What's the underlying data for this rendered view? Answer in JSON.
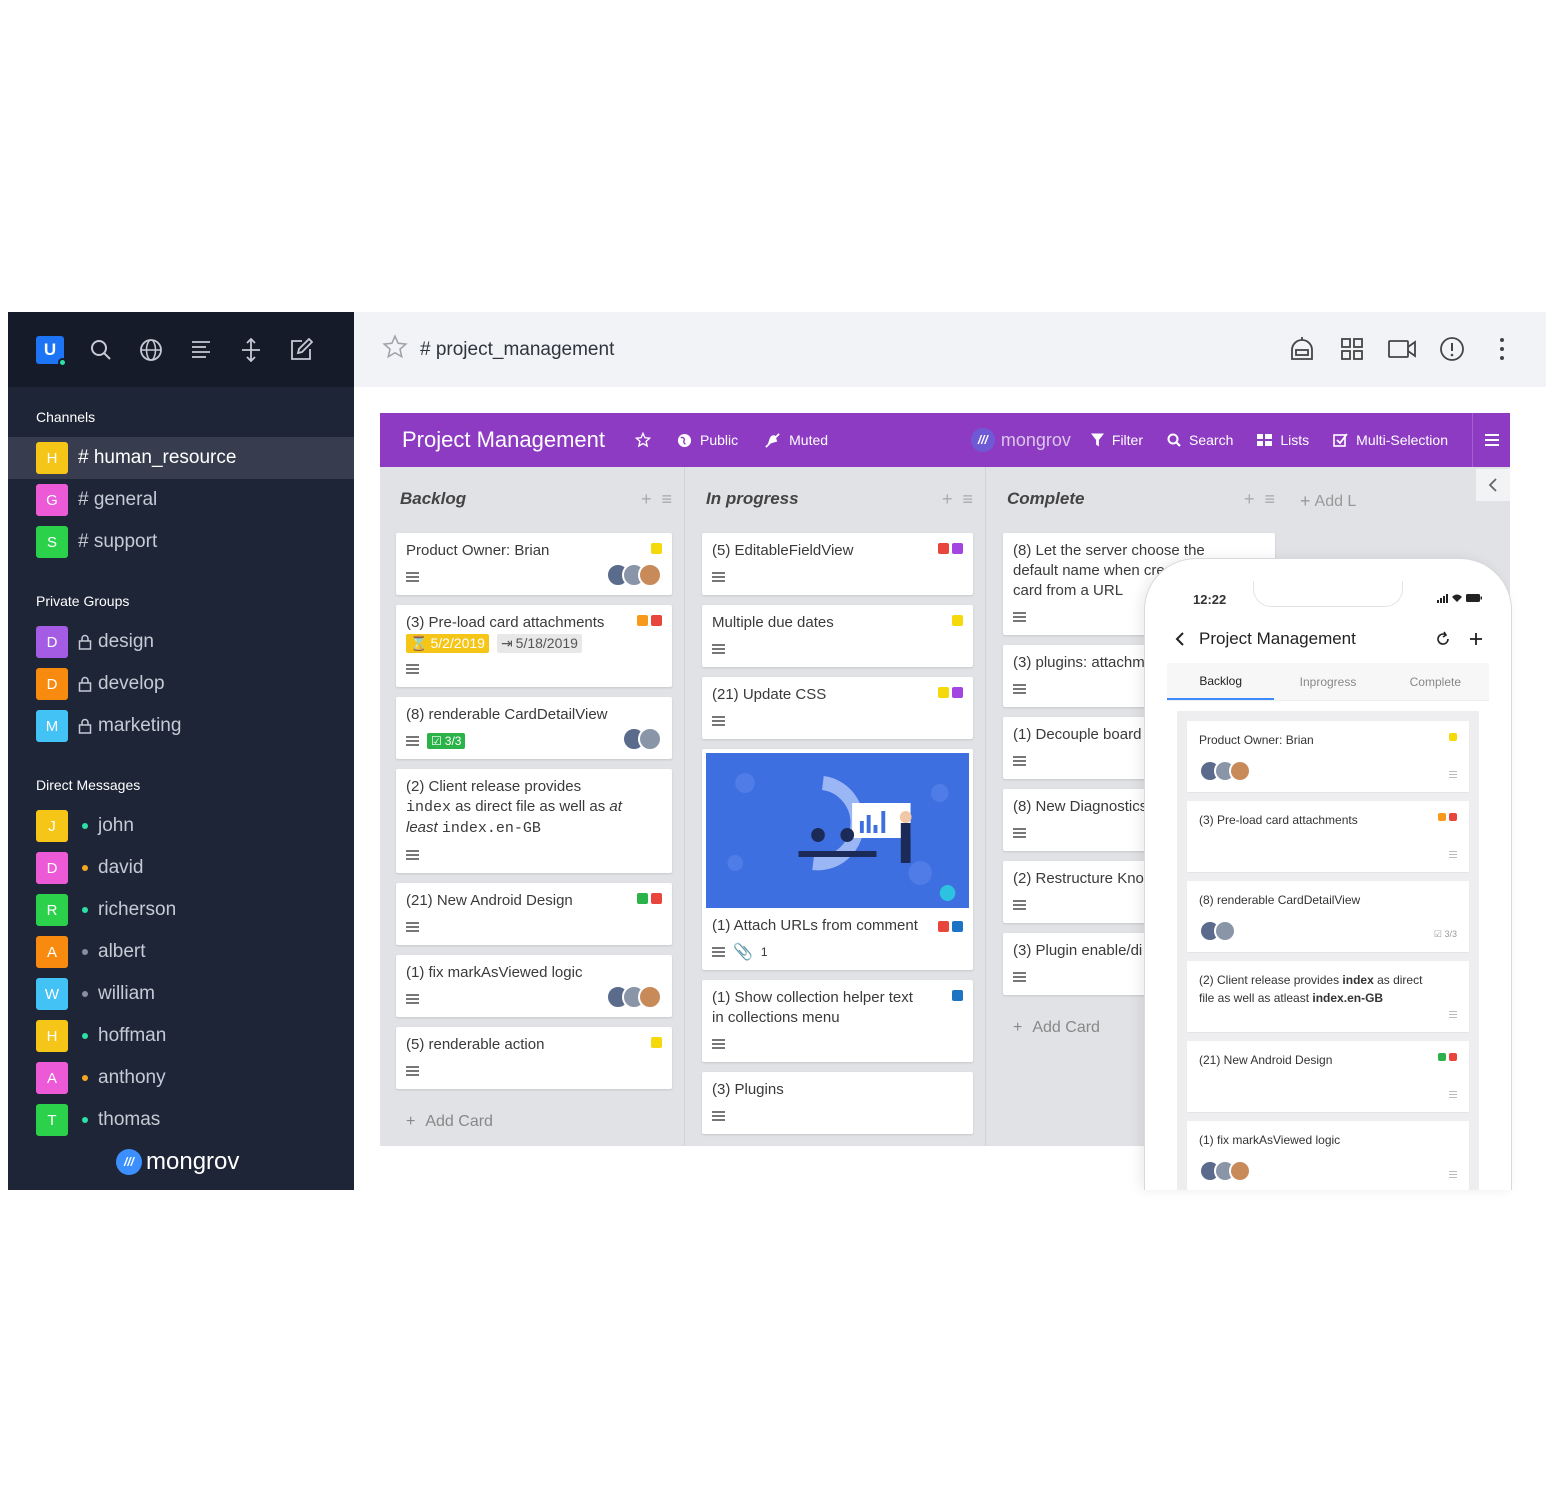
{
  "sidebar": {
    "user_initial": "U",
    "sections": {
      "channels": "Channels",
      "private_groups": "Private Groups",
      "direct_messages": "Direct Messages"
    },
    "channels": [
      {
        "initial": "H",
        "name": "# human_resource",
        "color": "#f5c518",
        "active": true
      },
      {
        "initial": "G",
        "name": "# general",
        "color": "#ec5ad8"
      },
      {
        "initial": "S",
        "name": "# support",
        "color": "#2bd14a"
      }
    ],
    "groups": [
      {
        "initial": "D",
        "name": "design",
        "color": "#a45ce4"
      },
      {
        "initial": "D",
        "name": "develop",
        "color": "#f88b0f"
      },
      {
        "initial": "M",
        "name": "marketing",
        "color": "#43c2f5"
      }
    ],
    "dms": [
      {
        "initial": "J",
        "name": "john",
        "color": "#f5c518",
        "status": "#2de0a5"
      },
      {
        "initial": "D",
        "name": "david",
        "color": "#ec5ad8",
        "status": "#f5a623"
      },
      {
        "initial": "R",
        "name": "richerson",
        "color": "#2bd14a",
        "status": "#2de0a5"
      },
      {
        "initial": "A",
        "name": "albert",
        "color": "#f88b0f",
        "status": "#8a8f9c"
      },
      {
        "initial": "W",
        "name": "william",
        "color": "#43c2f5",
        "status": "#8a8f9c"
      },
      {
        "initial": "H",
        "name": "hoffman",
        "color": "#f5c518",
        "status": "#2de0a5"
      },
      {
        "initial": "A",
        "name": "anthony",
        "color": "#ec5ad8",
        "status": "#f5a623"
      },
      {
        "initial": "T",
        "name": "thomas",
        "color": "#2bd14a",
        "status": "#2de0a5"
      }
    ],
    "brand": "mongrov"
  },
  "header": {
    "title": "# project_management"
  },
  "board": {
    "title": "Project Management",
    "public_label": "Public",
    "muted_label": "Muted",
    "brand": "mongrov",
    "filter_label": "Filter",
    "search_label": "Search",
    "lists_label": "Lists",
    "multi_label": "Multi-Selection",
    "add_list": "Add L",
    "add_card": "Add Card",
    "lists": [
      {
        "title": "Backlog",
        "cards": [
          {
            "text": "Product Owner: Brian",
            "labels": [
              "#f5d90a"
            ],
            "avatars": 3
          },
          {
            "text": "(3) Pre-load card attachments",
            "labels": [
              "#f79a1b",
              "#e8453c"
            ],
            "due": "5/2/2019",
            "start": "5/18/2019"
          },
          {
            "text": "(8) renderable CardDetailView",
            "check": "3/3",
            "avatars": 2
          },
          {
            "text_parts": [
              "(2) Client release provides ",
              "index",
              " as direct file as well as ",
              "at least",
              " ",
              "index.en-GB"
            ]
          },
          {
            "text": "(21) New Android Design",
            "labels": [
              "#2bb34a",
              "#e8453c"
            ]
          },
          {
            "text": "(1) fix markAsViewed logic",
            "avatars": 3
          },
          {
            "text": "(5) renderable action",
            "labels": [
              "#f5d90a"
            ]
          }
        ]
      },
      {
        "title": "In progress",
        "cards": [
          {
            "text": "(5) EditableFieldView",
            "labels": [
              "#e8453c",
              "#a345e0"
            ]
          },
          {
            "text": "Multiple due dates",
            "labels": [
              "#f5d90a"
            ]
          },
          {
            "text": "(21) Update CSS",
            "labels": [
              "#f5d90a",
              "#a345e0"
            ]
          },
          {
            "text": "(1) Attach URLs from comment",
            "labels": [
              "#e8453c",
              "#1d74c5"
            ],
            "attachments": "1",
            "image": true
          },
          {
            "text": "(1) Show collection helper text in collections menu",
            "labels": [
              "#1d74c5"
            ]
          },
          {
            "text": "(3) Plugins"
          }
        ]
      },
      {
        "title": "Complete",
        "cards": [
          {
            "text": "(8) Let the server choose the default name when creating a card from a URL"
          },
          {
            "text": "(3) plugins: attachm"
          },
          {
            "text": "(1) Decouple board"
          },
          {
            "text": "(8) New Diagnostics"
          },
          {
            "text": "(2) Restructure Kno"
          },
          {
            "text": "(3) Plugin enable/di"
          }
        ]
      }
    ]
  },
  "phone": {
    "time": "12:22",
    "title": "Project Management",
    "tabs": [
      "Backlog",
      "Inprogress",
      "Complete"
    ],
    "cards": [
      {
        "text": "Product Owner: Brian",
        "labels": [
          "#f5d90a"
        ],
        "avatars": 3
      },
      {
        "text": "(3) Pre-load card attachments",
        "labels": [
          "#f79a1b",
          "#e8453c"
        ]
      },
      {
        "text": "(8) renderable CardDetailView",
        "avatars": 2,
        "check": "3/3"
      },
      {
        "text_parts": [
          "(2) Client release provides ",
          "index",
          " as direct file as well as atleast ",
          "index.en-GB"
        ]
      },
      {
        "text": "(21) New Android Design",
        "labels": [
          "#2bb34a",
          "#e8453c"
        ]
      },
      {
        "text": "(1) fix markAsViewed logic",
        "avatars": 3
      }
    ]
  },
  "colors": {
    "sidebar_bg": "#1e2536",
    "purple": "#8e3bc3",
    "board_bg": "#e1e2e5"
  }
}
